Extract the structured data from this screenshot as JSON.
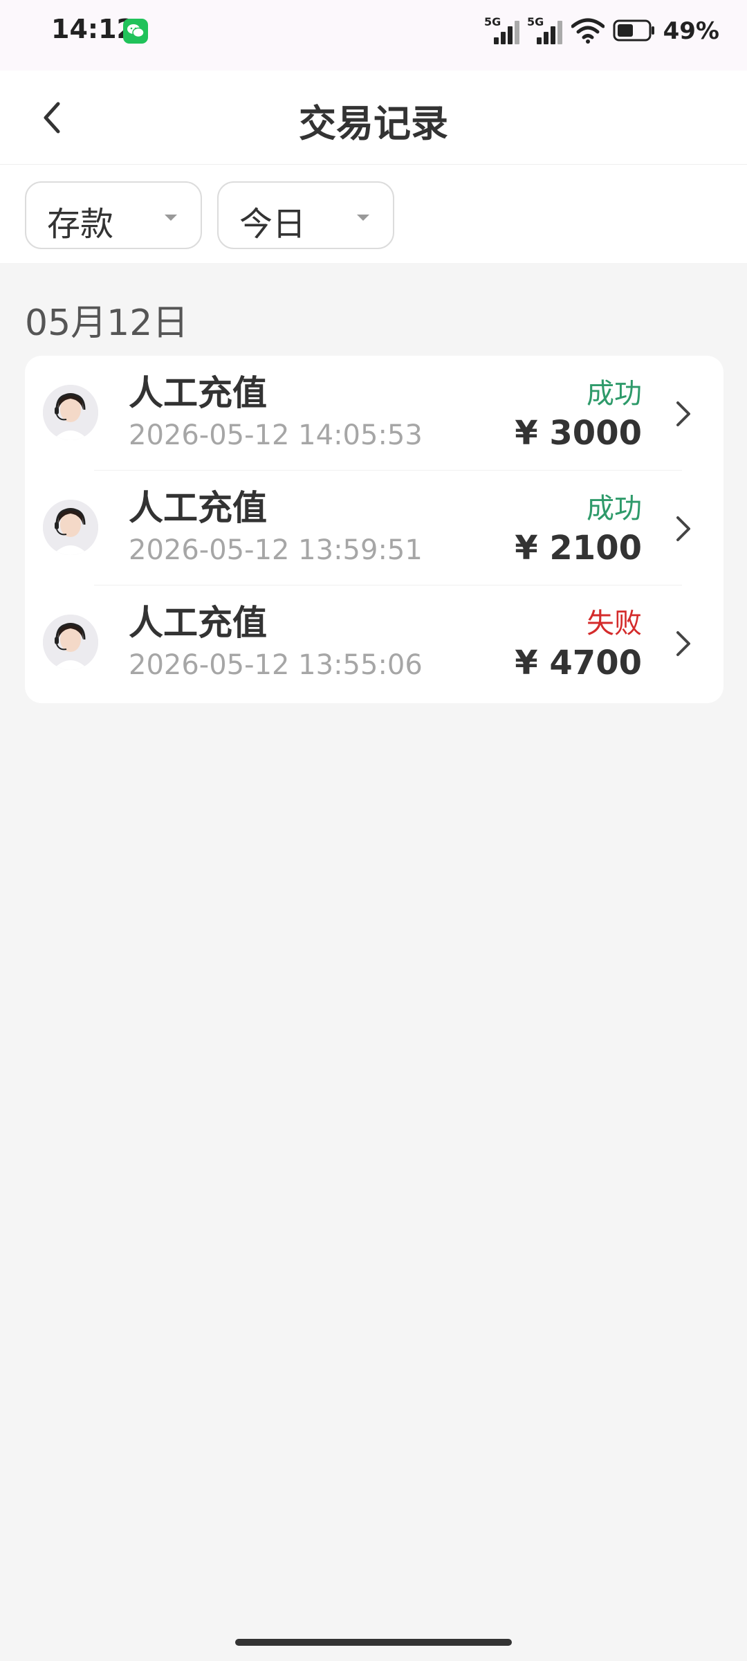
{
  "status_bar": {
    "time": "14:12",
    "network_1": "5G",
    "network_2": "5G",
    "battery": "49%",
    "icons": [
      "wechat-icon",
      "signal-icon",
      "wifi-icon",
      "battery-icon"
    ]
  },
  "header": {
    "title": "交易记录",
    "back_icon": "chevron-left-icon"
  },
  "filters": {
    "type": "存款",
    "period": "今日"
  },
  "section": {
    "date": "05月12日"
  },
  "colors": {
    "success": "#2e9a6a",
    "failure": "#d42b2b"
  },
  "transactions": [
    {
      "title": "人工充值",
      "time": "2026-05-12 14:05:53",
      "status": "成功",
      "status_type": "success",
      "amount": "¥ 3000"
    },
    {
      "title": "人工充值",
      "time": "2026-05-12 13:59:51",
      "status": "成功",
      "status_type": "success",
      "amount": "¥ 2100"
    },
    {
      "title": "人工充值",
      "time": "2026-05-12 13:55:06",
      "status": "失败",
      "status_type": "failure",
      "amount": "¥ 4700"
    }
  ]
}
